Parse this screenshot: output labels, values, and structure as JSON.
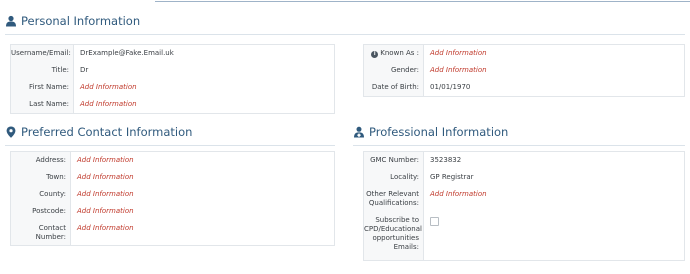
{
  "personal": {
    "title": "Personal Information",
    "icon": "user-icon",
    "left": [
      {
        "label": "Username/Email:",
        "value": "DrExample@Fake.Email.uk",
        "add": false
      },
      {
        "label": "Title:",
        "value": "Dr",
        "add": false
      },
      {
        "label": "First Name:",
        "value": "Add Information",
        "add": true
      },
      {
        "label": "Last Name:",
        "value": "Add Information",
        "add": true
      }
    ],
    "right": [
      {
        "label": "Known As :",
        "value": "Add Information",
        "add": true
      },
      {
        "label": "Gender:",
        "value": "Add Information",
        "add": true
      },
      {
        "label": "Date of Birth:",
        "value": "01/01/1970",
        "add": false
      }
    ]
  },
  "contact": {
    "title": "Preferred Contact Information",
    "icon": "map-marker-icon",
    "rows": [
      {
        "label": "Address:",
        "value": "Add Information",
        "add": true
      },
      {
        "label": "Town:",
        "value": "Add Information",
        "add": true
      },
      {
        "label": "County:",
        "value": "Add Information",
        "add": true
      },
      {
        "label": "Postcode:",
        "value": "Add Information",
        "add": true
      },
      {
        "label": "Contact Number:",
        "value": "Add Information",
        "add": true
      }
    ]
  },
  "professional": {
    "title": "Professional Information",
    "icon": "user-md-icon",
    "rows": [
      {
        "label": "GMC Number:",
        "value": "3523832",
        "add": false
      },
      {
        "label": "Locality:",
        "value": "GP Registrar",
        "add": false
      },
      {
        "label": "Other Relevant Qualifications:",
        "value": "Add Information",
        "add": true
      },
      {
        "label": "Subscribe to CPD/Educational opportunities Emails:",
        "value": "",
        "add": false,
        "checkbox": true,
        "checked": false
      }
    ]
  },
  "colors": {
    "accent": "#305a7d",
    "add_information": "#c0392b"
  }
}
